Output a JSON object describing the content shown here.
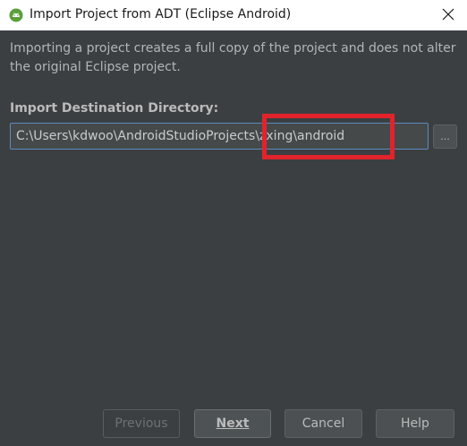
{
  "window": {
    "title": "Import Project from ADT (Eclipse Android)",
    "icon": "android-studio-icon"
  },
  "dialog": {
    "description": "Importing a project creates a full copy of the project and does not alter the original Eclipse project.",
    "destination_label": "Import Destination Directory:",
    "destination_value": "C:\\Users\\kdwoo\\AndroidStudioProjects\\zxing\\android",
    "browse_label": "...",
    "highlight_color": "#e2232b"
  },
  "buttons": {
    "previous": "Previous",
    "next": "Next",
    "cancel": "Cancel",
    "help": "Help"
  }
}
